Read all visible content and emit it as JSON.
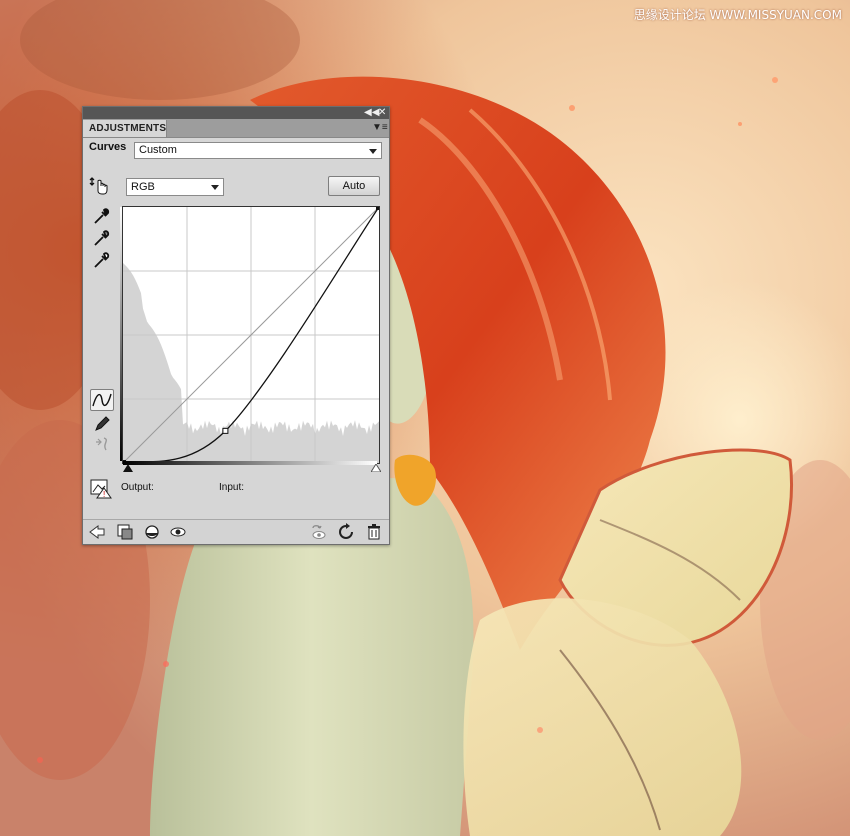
{
  "watermark": "思缘设计论坛 WWW.MISSYUAN.COM",
  "panel": {
    "tab_title": "ADJUSTMENTS",
    "adjustment_name": "Curves",
    "preset_value": "Custom",
    "channel_value": "RGB",
    "auto_label": "Auto",
    "output_label": "Output:",
    "input_label": "Input:"
  },
  "icons": {
    "titlebar": [
      "collapse-icon",
      "close-icon"
    ],
    "tools": [
      "on-image-adjust-icon",
      "black-point-eyedropper-icon",
      "gray-point-eyedropper-icon",
      "white-point-eyedropper-icon",
      "curve-edit-points-icon",
      "pencil-draw-icon",
      "smooth-curve-icon",
      "clipping-warning-icon"
    ],
    "bottom": [
      "back-arrow-icon",
      "clip-to-layer-icon",
      "visibility-toggle-icon",
      "view-previous-state-icon",
      "reset-icon",
      "delete-icon"
    ]
  },
  "colors": {
    "panel_bg": "#d6d6d6",
    "titlebar": "#565656",
    "curve": "#111111",
    "hair": "#d9441c"
  },
  "curve": {
    "points": [
      [
        0,
        0
      ],
      [
        102,
        32
      ],
      [
        255,
        255
      ]
    ]
  }
}
